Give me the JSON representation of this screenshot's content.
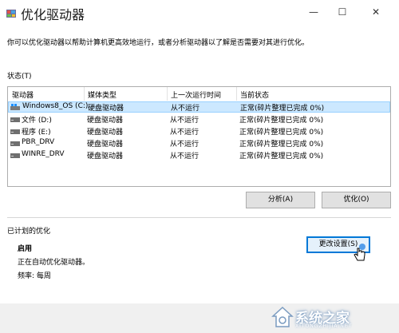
{
  "window": {
    "title": "优化驱动器",
    "minimize_glyph": "—",
    "maximize_glyph": "☐",
    "close_glyph": "✕"
  },
  "description": "你可以优化驱动器以帮助计算机更高效地运行，或者分析驱动器以了解是否需要对其进行优化。",
  "status_section": {
    "label": "状态(T)",
    "columns": [
      "驱动器",
      "媒体类型",
      "上一次运行时间",
      "当前状态"
    ],
    "drives": [
      {
        "name": "Windows8_OS (C:)",
        "media": "硬盘驱动器",
        "last_run": "从不运行",
        "status": "正常(碎片整理已完成 0%)"
      },
      {
        "name": "文件 (D:)",
        "media": "硬盘驱动器",
        "last_run": "从不运行",
        "status": "正常(碎片整理已完成 0%)"
      },
      {
        "name": "程序 (E:)",
        "media": "硬盘驱动器",
        "last_run": "从不运行",
        "status": "正常(碎片整理已完成 0%)"
      },
      {
        "name": "PBR_DRV",
        "media": "硬盘驱动器",
        "last_run": "从不运行",
        "status": "正常(碎片整理已完成 0%)"
      },
      {
        "name": "WINRE_DRV",
        "media": "硬盘驱动器",
        "last_run": "从不运行",
        "status": "正常(碎片整理已完成 0%)"
      }
    ],
    "selected_index": 0,
    "analyze_label": "分析(A)",
    "optimize_label": "优化(O)"
  },
  "scheduled_section": {
    "label": "已计划的优化",
    "state": "启用",
    "auto_text": "正在自动优化驱动器。",
    "frequency_text": "频率: 每周",
    "change_settings_label": "更改设置(S)"
  },
  "watermark": {
    "text": "系统之家",
    "sub": "XITONGZHIJIA.NET"
  },
  "colors": {
    "selection_bg": "#cce8ff",
    "button_bg": "#e1e1e1",
    "focus_border": "#0078d7"
  }
}
